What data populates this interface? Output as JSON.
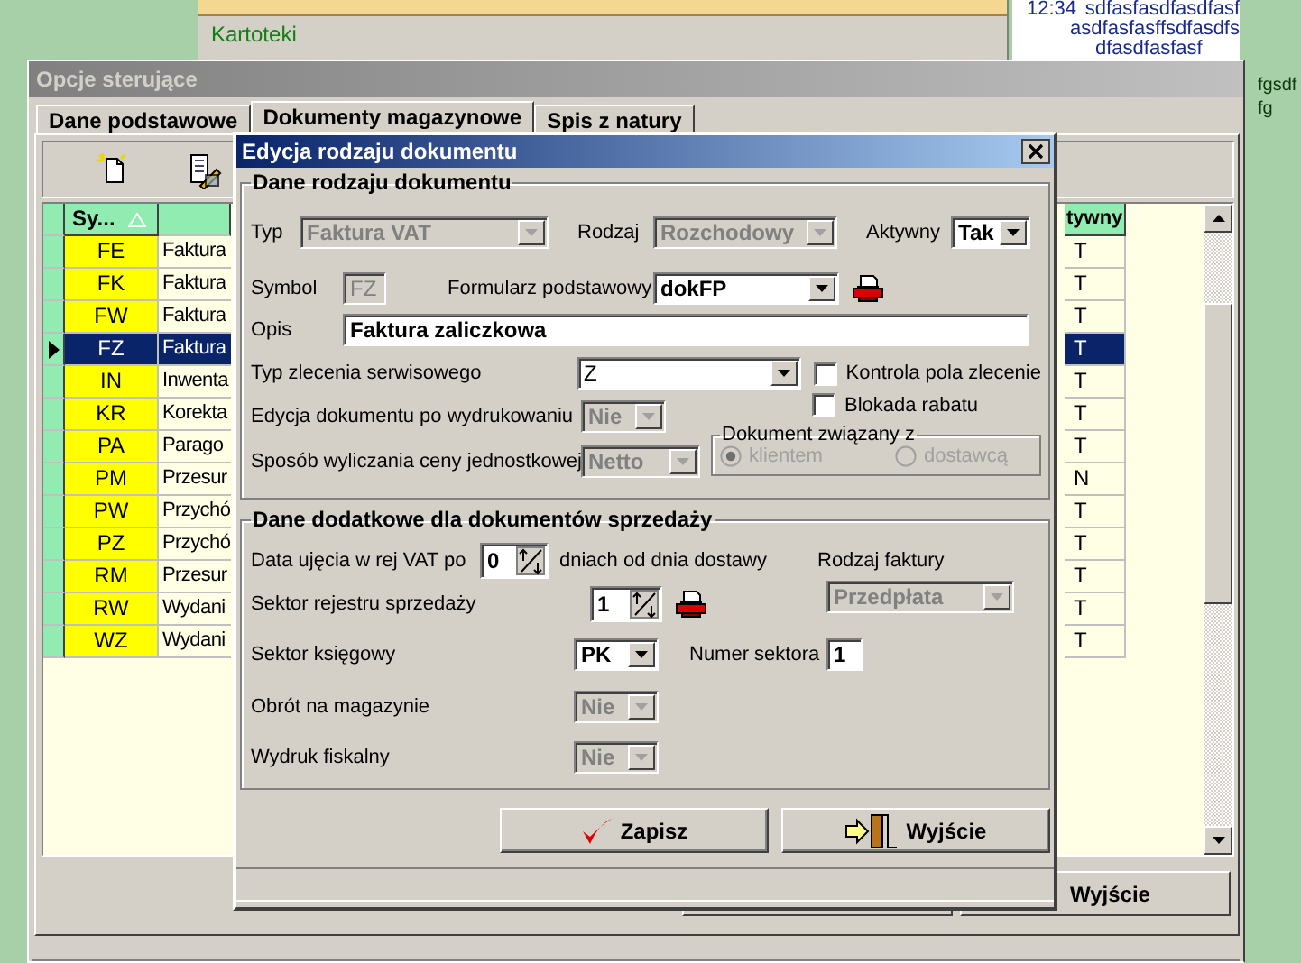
{
  "background": {
    "panel_label": "Kartoteki",
    "messages": [
      {
        "time": "12:34",
        "text": "sdfasfasdfasdfasf"
      },
      {
        "text": "asdfasfasffsdfasdfs"
      },
      {
        "text": "dfasdfasfasf"
      }
    ],
    "side_texts": [
      "fgsdf",
      "fg"
    ]
  },
  "window": {
    "title": "Opcje sterujące",
    "tabs": [
      {
        "label": "Dane podstawowe",
        "selected": false
      },
      {
        "label": "Dokumenty magazynowe",
        "selected": true
      },
      {
        "label": "Spis z natury",
        "selected": false
      }
    ],
    "grid": {
      "columns": [
        {
          "label": "Sy...",
          "sorted": true
        },
        {
          "label": "tywny"
        }
      ],
      "rows": [
        {
          "symbol": "FE",
          "description": "Faktura",
          "active": "T",
          "selected": false
        },
        {
          "symbol": "FK",
          "description": "Faktura",
          "active": "T",
          "selected": false
        },
        {
          "symbol": "FW",
          "description": "Faktura",
          "active": "T",
          "selected": false
        },
        {
          "symbol": "FZ",
          "description": "Faktura",
          "active": "T",
          "selected": true
        },
        {
          "symbol": "IN",
          "description": "Inwenta",
          "active": "T",
          "selected": false
        },
        {
          "symbol": "KR",
          "description": "Korekta",
          "active": "T",
          "selected": false
        },
        {
          "symbol": "PA",
          "description": "Parago",
          "active": "T",
          "selected": false
        },
        {
          "symbol": "PM",
          "description": "Przesur",
          "active": "N",
          "selected": false
        },
        {
          "symbol": "PW",
          "description": "Przychó",
          "active": "T",
          "selected": false
        },
        {
          "symbol": "PZ",
          "description": "Przychó",
          "active": "T",
          "selected": false
        },
        {
          "symbol": "RM",
          "description": "Przesur",
          "active": "T",
          "selected": false
        },
        {
          "symbol": "RW",
          "description": "Wydani",
          "active": "T",
          "selected": false
        },
        {
          "symbol": "WZ",
          "description": "Wydani",
          "active": "T",
          "selected": false
        }
      ]
    },
    "buttons": [
      "Wyjście"
    ]
  },
  "dialog": {
    "title": "Edycja rodzaju dokumentu",
    "section1": {
      "title": "Dane rodzaju dokumentu",
      "typ": {
        "label": "Typ",
        "value": "Faktura VAT",
        "disabled": true
      },
      "rodzaj": {
        "label": "Rodzaj",
        "value": "Rozchodowy",
        "disabled": true
      },
      "aktywny": {
        "label": "Aktywny",
        "value": "Tak",
        "disabled": false
      },
      "symbol": {
        "label": "Symbol",
        "value": "FZ",
        "disabled": true
      },
      "formularz": {
        "label": "Formularz podstawowy",
        "value": "dokFP",
        "disabled": false
      },
      "opis": {
        "label": "Opis",
        "value": "Faktura zaliczkowa"
      },
      "typ_zlecenia": {
        "label": "Typ zlecenia serwisowego",
        "value": "Z",
        "disabled": false
      },
      "kontrola": {
        "label": "Kontrola pola zlecenie",
        "checked": false
      },
      "blokada": {
        "label": "Blokada rabatu",
        "checked": false
      },
      "edycja": {
        "label": "Edycja dokumentu po wydrukowaniu",
        "value": "Nie",
        "disabled": true
      },
      "sposob": {
        "label": "Sposób wyliczania ceny jednostkowej",
        "value": "Netto",
        "disabled": true
      },
      "dokument_zwiazany": {
        "title": "Dokument związany z",
        "disabled": true,
        "options": [
          {
            "label": "klientem",
            "selected": true
          },
          {
            "label": "dostawcą",
            "selected": false
          }
        ]
      }
    },
    "section2": {
      "title": "Dane dodatkowe dla dokumentów sprzedaży",
      "data_ujecia": {
        "label": "Data ujęcia w rej VAT po",
        "value": "0",
        "suffix": "dniach od dnia dostawy"
      },
      "rodzaj_faktury": {
        "label": "Rodzaj faktury",
        "value": "Przedpłata",
        "disabled": true
      },
      "sektor_rejestru": {
        "label": "Sektor rejestru sprzedaży",
        "value": "1"
      },
      "sektor_ksiegowy": {
        "label": "Sektor księgowy",
        "value": "PK",
        "disabled": false
      },
      "numer_sektora": {
        "label": "Numer sektora",
        "value": "1"
      },
      "obrot": {
        "label": "Obrót na magazynie",
        "value": "Nie",
        "disabled": true
      },
      "wydruk": {
        "label": "Wydruk fiskalny",
        "value": "Nie",
        "disabled": true
      }
    },
    "buttons": [
      {
        "label": "Zapisz",
        "kind": "save"
      },
      {
        "label": "Wyjście",
        "kind": "exit"
      }
    ]
  }
}
